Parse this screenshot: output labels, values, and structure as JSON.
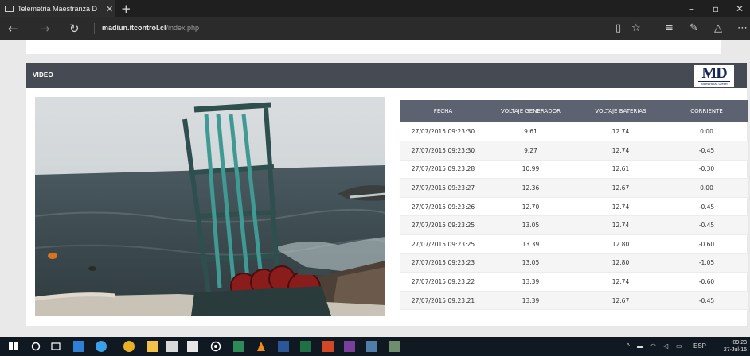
{
  "browser": {
    "tab_title": "Telemetria Maestranza D",
    "tab_close": "✕",
    "new_tab": "+",
    "url_host": "madiun.itcontrol.cl",
    "url_path": "/index.php",
    "win_minimize": "–",
    "win_maximize": "▫",
    "win_close": "✕"
  },
  "panel": {
    "title": "VIDEO",
    "logo_text": "MD",
    "logo_sub": "Maestranza Diesel"
  },
  "table": {
    "headers": [
      "FECHA",
      "VOLTAJE GENERADOR",
      "VOLTAJE BATERIAS",
      "CORRIENTE"
    ],
    "rows": [
      [
        "27/07/2015 09:23:30",
        "9.61",
        "12.74",
        "0.00"
      ],
      [
        "27/07/2015 09:23:30",
        "9.27",
        "12.74",
        "-0.45"
      ],
      [
        "27/07/2015 09:23:28",
        "10.99",
        "12.61",
        "-0.30"
      ],
      [
        "27/07/2015 09:23:27",
        "12.36",
        "12.67",
        "0.00"
      ],
      [
        "27/07/2015 09:23:26",
        "12.70",
        "12.74",
        "-0.45"
      ],
      [
        "27/07/2015 09:23:25",
        "13.05",
        "12.74",
        "-0.45"
      ],
      [
        "27/07/2015 09:23:25",
        "13.39",
        "12.80",
        "-0.60"
      ],
      [
        "27/07/2015 09:23:23",
        "13.05",
        "12.80",
        "-1.05"
      ],
      [
        "27/07/2015 09:23:22",
        "13.39",
        "12.74",
        "-0.60"
      ],
      [
        "27/07/2015 09:23:21",
        "13.39",
        "12.67",
        "-0.45"
      ]
    ]
  },
  "taskbar": {
    "lang": "ESP",
    "time": "09:23",
    "date": "27-Jul-15"
  },
  "colors": {
    "panel_header": "#464a52",
    "table_header": "#5c6270",
    "taskbar": "#101822"
  }
}
